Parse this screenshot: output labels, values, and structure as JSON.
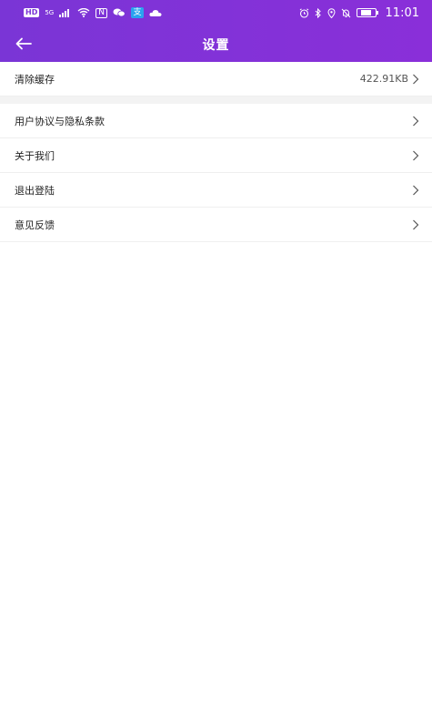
{
  "status_bar": {
    "hd": "HD",
    "network": "5G",
    "nfc": "N",
    "alipay": "支",
    "time": "11:01"
  },
  "header": {
    "title": "设置"
  },
  "settings": {
    "cache": {
      "label": "清除缓存",
      "value": "422.91KB"
    },
    "items": [
      {
        "label": "用户协议与隐私条款"
      },
      {
        "label": "关于我们"
      },
      {
        "label": "退出登陆"
      },
      {
        "label": "意见反馈"
      }
    ]
  },
  "colors": {
    "header_bg": "#7a35d6",
    "header_text": "#ffffff",
    "divider": "#efefef",
    "spacer_bg": "#f3f3f3"
  },
  "icons": {
    "back": "arrow-left-icon",
    "row_chevron": "chevron-right-icon"
  }
}
